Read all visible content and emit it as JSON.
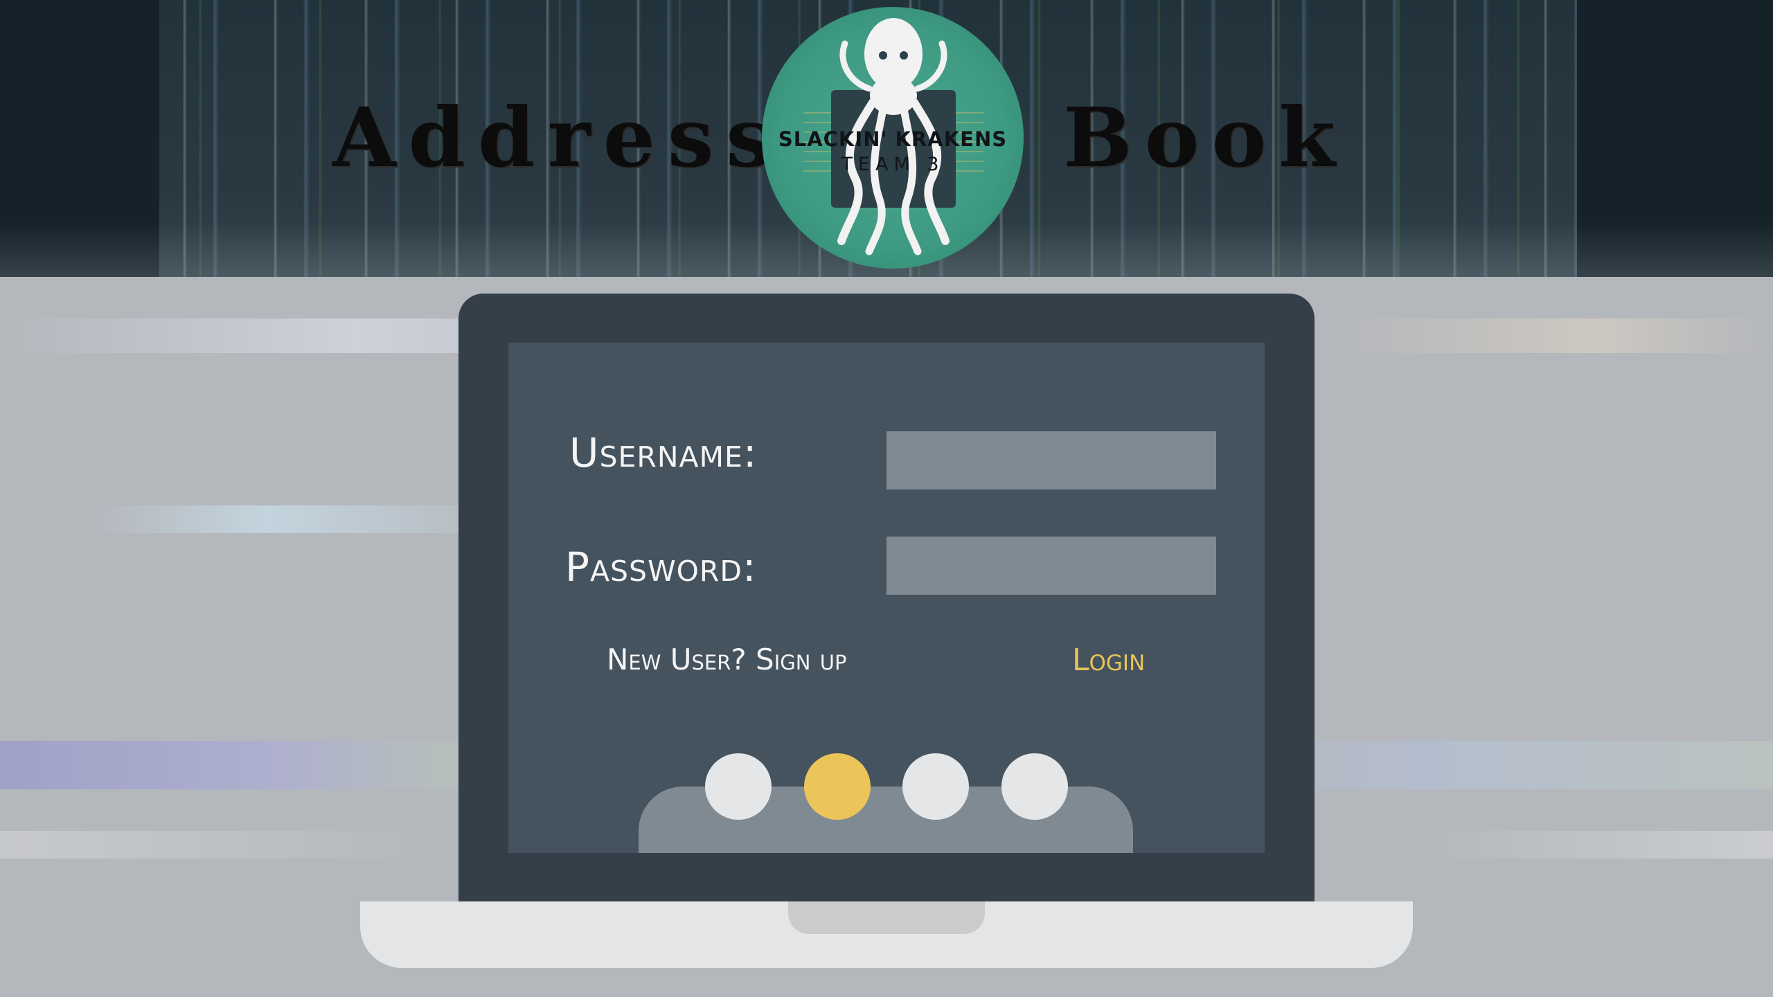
{
  "header": {
    "title_left": "Address",
    "title_right": "Book",
    "logo": {
      "line1": "SLACKIN' KRAKENS",
      "line2": "TEAM 3"
    }
  },
  "login_form": {
    "username_label": "Username:",
    "username_value": "",
    "password_label": "Password:",
    "password_value": "",
    "signup_link": "New User? Sign up",
    "login_button": "Login"
  },
  "decor": {
    "indicator_dots": [
      "light",
      "accent",
      "light",
      "light"
    ],
    "accent_color": "#ecc55a",
    "screen_color": "#45535f",
    "input_color": "#7f8a93"
  }
}
